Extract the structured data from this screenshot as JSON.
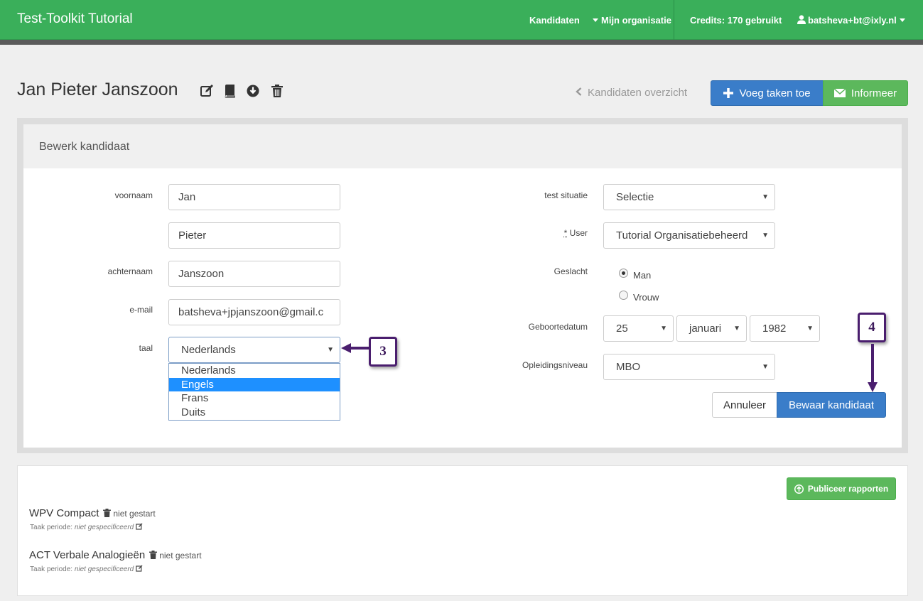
{
  "navbar": {
    "brand": "Test-Toolkit Tutorial",
    "candidates": "Kandidaten",
    "organization": "Mijn organisatie",
    "credits": "Credits: 170 gebruikt",
    "user": "batsheva+bt@ixly.nl"
  },
  "header": {
    "title": "Jan Pieter Janszoon",
    "back_link": "Kandidaten overzicht",
    "add_tasks_button": "Voeg taken toe",
    "inform_button": "Informeer"
  },
  "panel": {
    "heading": "Bewerk kandidaat",
    "labels": {
      "first_name": "voornaam",
      "last_name": "achternaam",
      "email": "e-mail",
      "language": "taal",
      "test_situation": "test situatie",
      "user_required": "*",
      "user": " User",
      "gender": "Geslacht",
      "birthdate": "Geboortedatum",
      "education": "Opleidingsniveau"
    },
    "values": {
      "first_name": "Jan",
      "middle_name": "Pieter",
      "last_name": "Janszoon",
      "email": "batsheva+jpjanszoon@gmail.c",
      "language": "Nederlands",
      "test_situation": "Selectie",
      "user": "Tutorial Organisatiebeheerd",
      "gender_male": "Man",
      "gender_female": "Vrouw",
      "gender_selected": "Man",
      "birth_day": "25",
      "birth_month": "januari",
      "birth_year": "1982",
      "education": "MBO"
    },
    "language_options": [
      "Nederlands",
      "Engels",
      "Frans",
      "Duits"
    ],
    "language_highlighted": "Engels",
    "cancel_button": "Annuleer",
    "save_button": "Bewaar kandidaat"
  },
  "callouts": {
    "step3": "3",
    "step4": "4"
  },
  "tasks": {
    "publish_button": "Publiceer rapporten",
    "items": [
      {
        "name": "WPV Compact",
        "status": "niet gestart",
        "period_label": "Taak periode:",
        "period_value": "niet gespecificeerd"
      },
      {
        "name": "ACT Verbale Analogieën",
        "status": "niet gestart",
        "period_label": "Taak periode:",
        "period_value": "niet gespecificeerd"
      }
    ]
  },
  "colors": {
    "navbar": "#3aaf5a",
    "primary": "#3a7dc9",
    "success": "#5cb85c",
    "callout": "#4a1e6e",
    "highlight": "#1e90ff"
  }
}
